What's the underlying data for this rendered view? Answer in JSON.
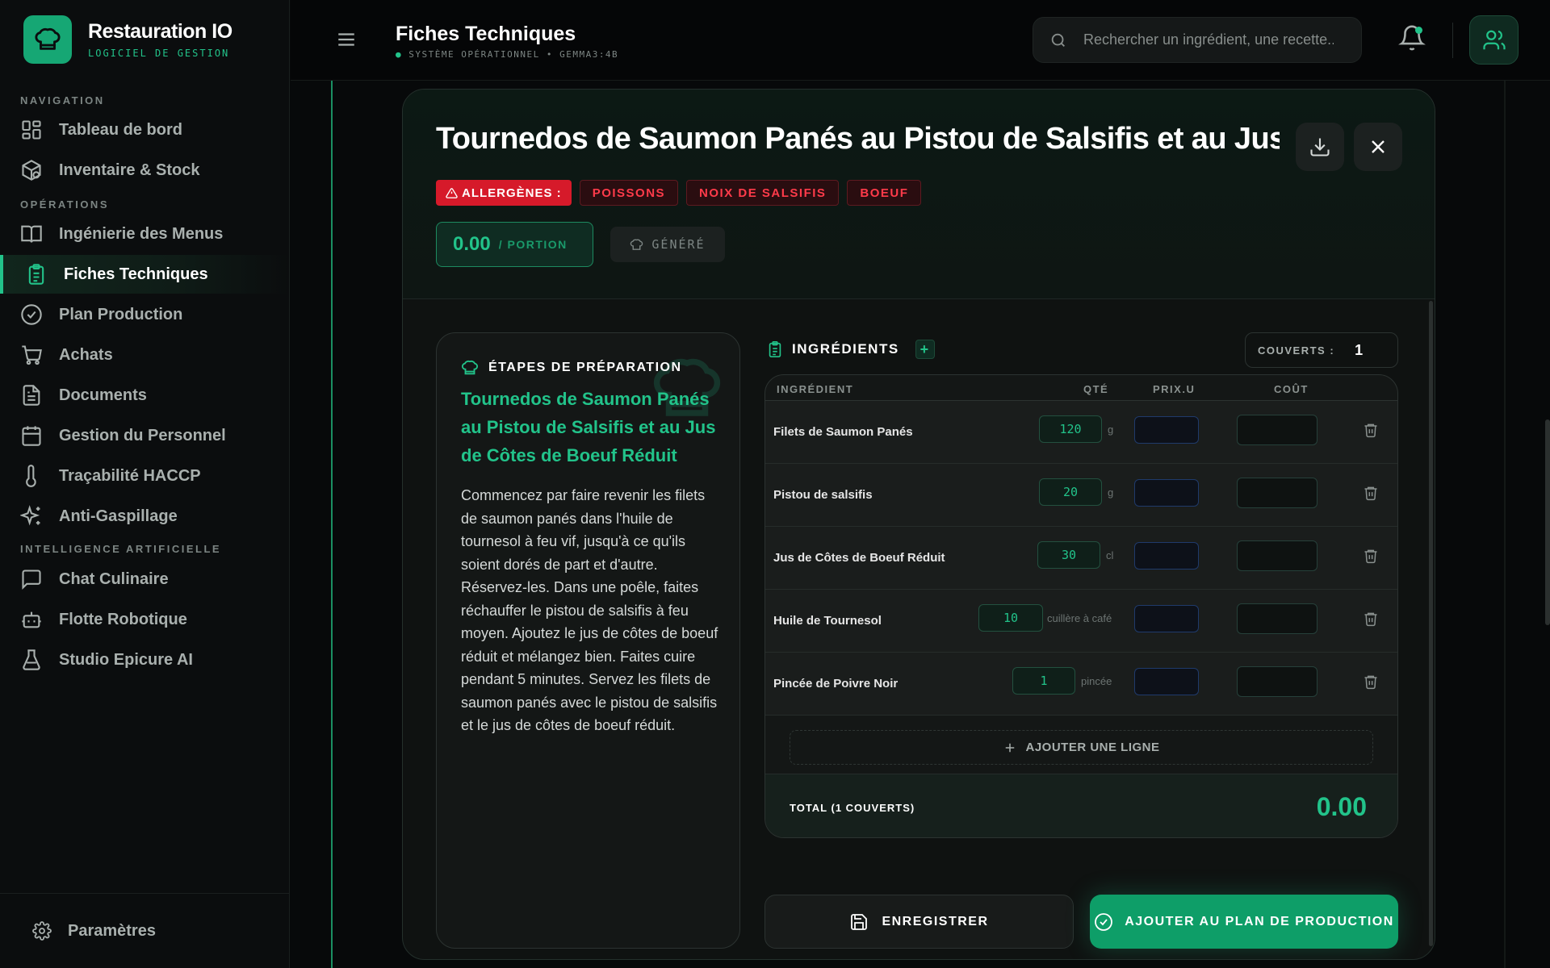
{
  "brand": {
    "title": "Restauration IO",
    "subtitle": "LOGICIEL DE GESTION"
  },
  "sidebar": {
    "sections": {
      "navigation": "NAVIGATION",
      "operations": "OPÉRATIONS",
      "ai": "INTELLIGENCE ARTIFICIELLE"
    },
    "items": [
      {
        "label": "Tableau de bord",
        "icon": "dashboard-icon"
      },
      {
        "label": "Inventaire & Stock",
        "icon": "package-icon"
      },
      {
        "label": "Ingénierie des Menus",
        "icon": "book-icon"
      },
      {
        "label": "Fiches Techniques",
        "icon": "clipboard-icon",
        "active": true
      },
      {
        "label": "Plan Production",
        "icon": "check-circle-icon"
      },
      {
        "label": "Achats",
        "icon": "cart-icon"
      },
      {
        "label": "Documents",
        "icon": "document-icon"
      },
      {
        "label": "Gestion du Personnel",
        "icon": "calendar-icon"
      },
      {
        "label": "Traçabilité HACCP",
        "icon": "thermometer-icon"
      },
      {
        "label": "Anti-Gaspillage",
        "icon": "sparkles-icon"
      },
      {
        "label": "Chat Culinaire",
        "icon": "chat-icon"
      },
      {
        "label": "Flotte Robotique",
        "icon": "robot-icon"
      },
      {
        "label": "Studio Epicure AI",
        "icon": "flask-icon"
      }
    ],
    "settings": "Paramètres"
  },
  "header": {
    "title": "Fiches Techniques",
    "status": "SYSTÈME OPÉRATIONNEL",
    "model": "GEMMA3:4B",
    "search_placeholder": "Rechercher un ingrédient, une recette..."
  },
  "recipe": {
    "title": "Tournedos de Saumon Panés au Pistou de Salsifis et au Jus de Côtes de Boeuf Réduit",
    "allergens_label": "ALLERGÈNES :",
    "allergens": [
      "POISSONS",
      "NOIX DE SALSIFIS",
      "BOEUF"
    ],
    "price": "0.00",
    "price_unit": "/ PORTION",
    "generated_badge": "GÉNÉRÉ"
  },
  "preparation": {
    "heading": "ÉTAPES DE PRÉPARATION",
    "recipe_name": "Tournedos de Saumon Panés au Pistou de Salsifis et au Jus de Côtes de Boeuf Réduit",
    "text": "Commencez par faire revenir les filets de saumon panés dans l'huile de tournesol à feu vif, jusqu'à ce qu'ils soient dorés de part et d'autre. Réservez-les. Dans une poêle, faites réchauffer le pistou de salsifis à feu moyen. Ajoutez le jus de côtes de boeuf réduit et mélangez bien. Faites cuire pendant 5 minutes. Servez les filets de saumon panés avec le pistou de salsifis et le jus de côtes de boeuf réduit."
  },
  "ingredients": {
    "heading": "INGRÉDIENTS",
    "add_symbol": "+",
    "couverts_label": "COUVERTS :",
    "couverts_value": "1",
    "columns": [
      "INGRÉDIENT",
      "QTÉ",
      "PRIX.U",
      "COÛT"
    ],
    "rows": [
      {
        "name": "Filets de Saumon Panés",
        "qty": "120",
        "unit": "g"
      },
      {
        "name": "Pistou de salsifis",
        "qty": "20",
        "unit": "g"
      },
      {
        "name": "Jus de Côtes de Boeuf Réduit",
        "qty": "30",
        "unit": "cl"
      },
      {
        "name": "Huile de Tournesol",
        "qty": "10",
        "unit": "cuillère à café"
      },
      {
        "name": "Pincée de Poivre Noir",
        "qty": "1",
        "unit": "pincée"
      }
    ],
    "add_line": "AJOUTER UNE LIGNE",
    "total_label": "TOTAL (1 COUVERTS)",
    "total_value": "0.00"
  },
  "actions": {
    "save": "ENREGISTRER",
    "add_to_plan": "AJOUTER AU PLAN DE PRODUCTION"
  },
  "colors": {
    "accent": "#22c38a",
    "danger": "#d61a2a",
    "background": "#07090a"
  }
}
